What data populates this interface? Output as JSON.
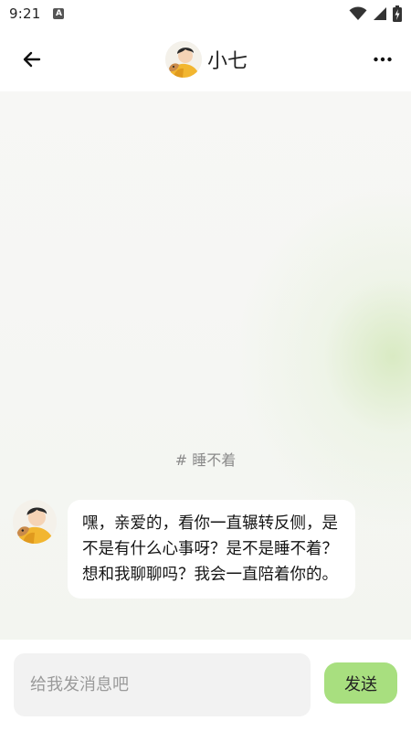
{
  "status_bar": {
    "time": "9:21",
    "app_indicator": "A",
    "icons": [
      "wifi-icon",
      "signal-icon",
      "battery-charging-icon"
    ]
  },
  "header": {
    "back_icon": "arrow-left-icon",
    "title": "小七",
    "more_icon": "more-horizontal-icon"
  },
  "chat": {
    "topic": "# 睡不着",
    "messages": [
      {
        "sender": "小七",
        "text": "嘿，亲爱的，看你一直辗转反侧，是不是有什么心事呀？是不是睡不着？想和我聊聊吗？我会一直陪着你的。"
      }
    ]
  },
  "composer": {
    "placeholder": "给我发消息吧",
    "value": "",
    "send_label": "发送"
  },
  "colors": {
    "send_button": "#a8df7f",
    "input_background": "#f2f2f2",
    "chat_background": "#f6f7f4",
    "accent_glow": "#d6e9be"
  }
}
